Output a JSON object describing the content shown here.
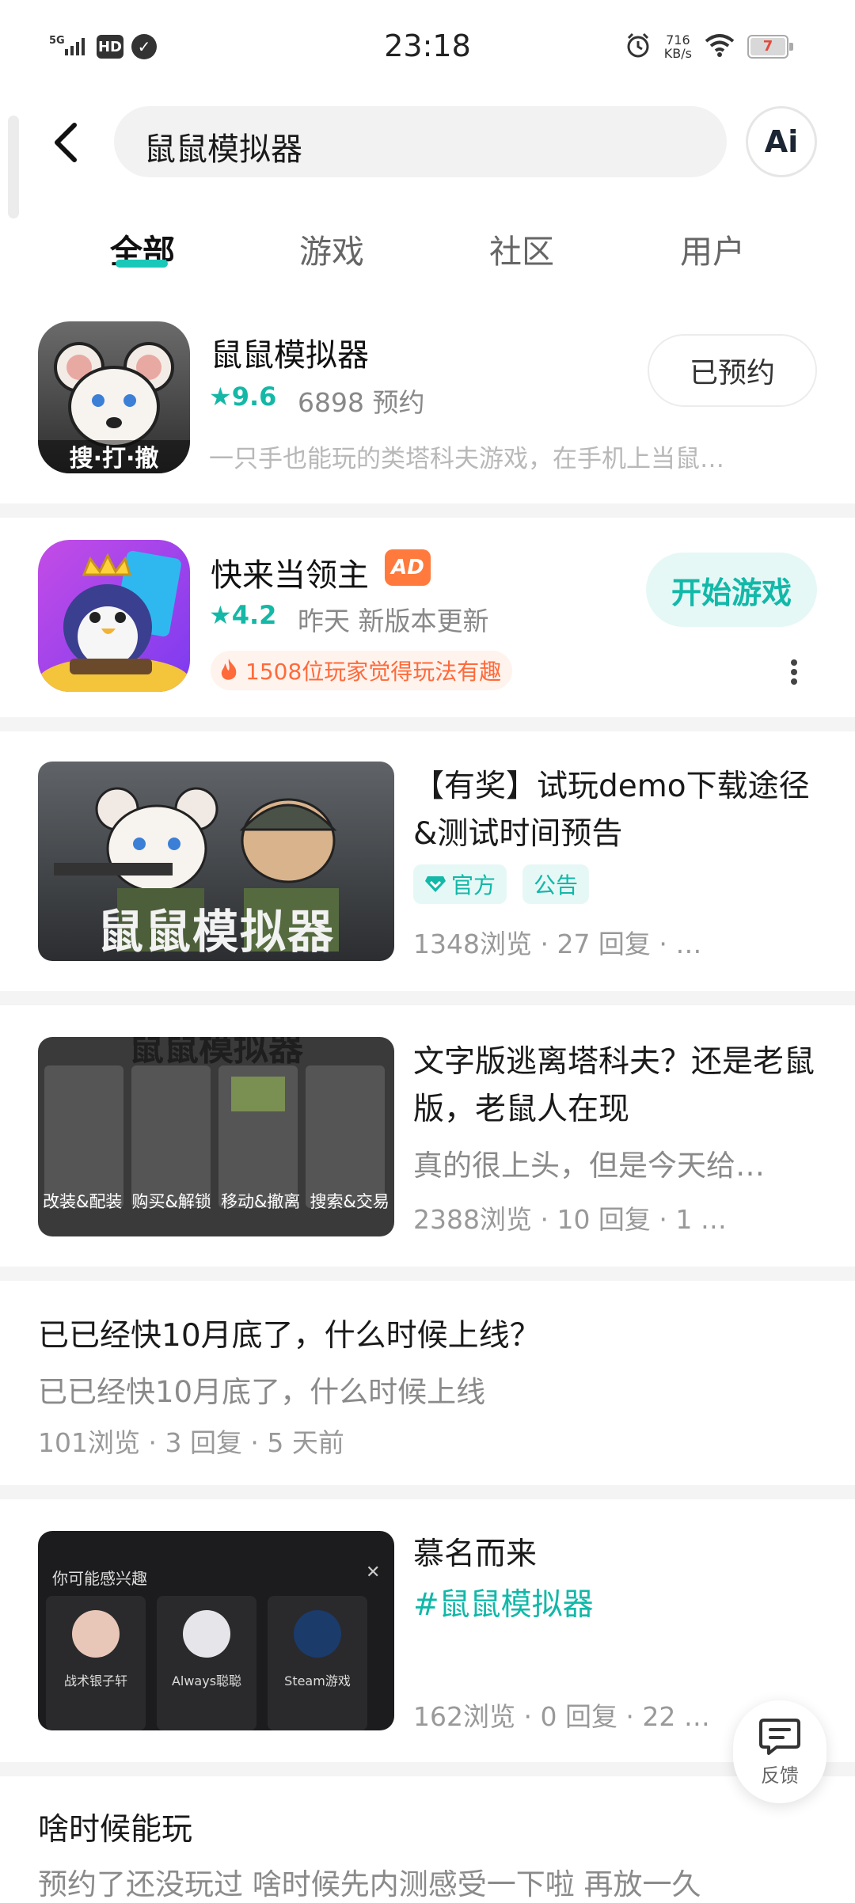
{
  "status_bar": {
    "time": "23:18",
    "network": "5G",
    "hd": "HD",
    "net_speed_value": "716",
    "net_speed_unit": "KB/s",
    "battery": "7"
  },
  "search": {
    "query": "鼠鼠模拟器",
    "ai_label": "Ai"
  },
  "tabs": [
    {
      "label": "全部",
      "active": true
    },
    {
      "label": "游戏",
      "active": false
    },
    {
      "label": "社区",
      "active": false
    },
    {
      "label": "用户",
      "active": false
    }
  ],
  "apps": [
    {
      "icon_badge": "搜·打·撤",
      "name": "鼠鼠模拟器",
      "rating": "★9.6",
      "meta": "6898 预约",
      "desc": "一只手也能玩的类塔科夫游戏，在手机上当鼠…",
      "button": "已预约"
    },
    {
      "name": "快来当领主",
      "ad": "AD",
      "rating": "★4.2",
      "meta": "昨天 新版本更新",
      "hot": "1508位玩家觉得玩法有趣",
      "button": "开始游戏"
    }
  ],
  "posts": [
    {
      "thumb_text": "鼠鼠模拟器",
      "title": "【有奖】试玩demo下载途径&测试时间预告",
      "tags": [
        "官方",
        "公告"
      ],
      "meta": "1348浏览 · 27 回复 · …"
    },
    {
      "thumb_text": "鼠鼠模拟器",
      "thumb_labels": [
        "改装&配装",
        "购买&解锁",
        "移动&撤离",
        "搜索&交易"
      ],
      "title": "文字版逃离塔科夫？还是老鼠版，老鼠人在现",
      "sub": "真的很上头，但是今天给…",
      "meta": "2388浏览 · 10 回复 · 1 …"
    },
    {
      "title": "已已经快10月底了，什么时候上线？",
      "sub": "已已经快10月底了，什么时候上线",
      "meta": "101浏览 · 3 回复 · 5 天前"
    },
    {
      "thumb_header": "你可能感兴趣",
      "thumb_users": [
        "战术银子轩",
        "Always聪聪",
        "Steam游戏"
      ],
      "title": "慕名而来",
      "hashtag": "#鼠鼠模拟器",
      "meta": "162浏览 · 0 回复 · 22 …"
    },
    {
      "title": "啥时候能玩",
      "sub": "预约了还没玩过 啥时候先内测感受一下啦 再放一久"
    }
  ],
  "fab": {
    "label": "反馈"
  },
  "colors": {
    "accent": "#12b8a8",
    "ad": "#ff7a3c",
    "hot": "#ff6a3a"
  }
}
